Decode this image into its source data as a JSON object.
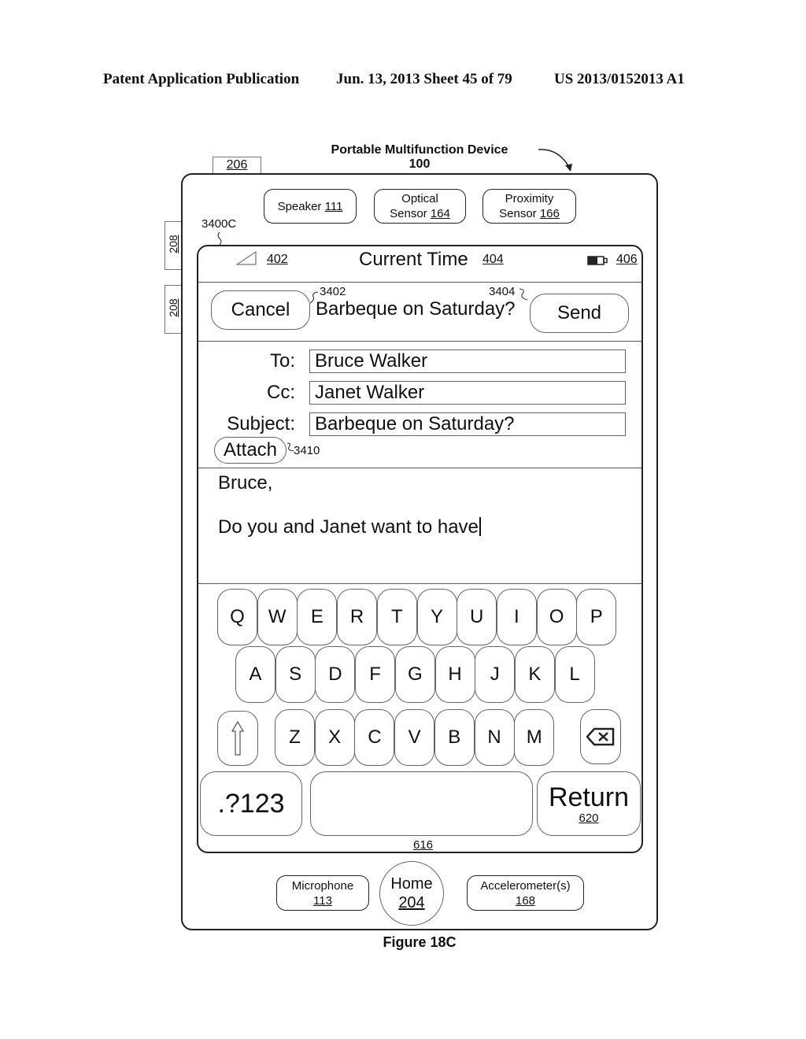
{
  "header": {
    "publication": "Patent Application Publication",
    "date_sheet": "Jun. 13, 2013  Sheet 45 of 79",
    "patent_number": "US 2013/0152013 A1"
  },
  "device": {
    "title": "Portable Multifunction Device",
    "ref": "100",
    "tab_top_ref": "206",
    "side_button_refs": [
      "208",
      "208"
    ],
    "screen_ref": "3400C",
    "top_hardware": [
      {
        "line1": "Speaker",
        "ref": "111"
      },
      {
        "line1": "Optical",
        "line2": "Sensor",
        "ref": "164"
      },
      {
        "line1": "Proximity",
        "line2": "Sensor",
        "ref": "166"
      }
    ],
    "bottom_hardware": [
      {
        "label": "Microphone",
        "ref": "113"
      },
      {
        "label": "Home",
        "ref": "204"
      },
      {
        "label": "Accelerometer(s)",
        "ref": "168"
      }
    ]
  },
  "status_bar": {
    "signal_ref": "402",
    "time_label": "Current Time",
    "time_ref": "404",
    "battery_ref": "406"
  },
  "nav": {
    "cancel_label": "Cancel",
    "cancel_ref": "3402",
    "title": "Barbeque on Saturday?",
    "send_ref": "3404",
    "send_label": "Send"
  },
  "compose": {
    "to_label": "To:",
    "to_value": "Bruce Walker",
    "cc_label": "Cc:",
    "cc_value": "Janet Walker",
    "subject_label": "Subject:",
    "subject_value": "Barbeque on Saturday?",
    "attach_label": "Attach",
    "attach_ref": "3410",
    "body_line1": "Bruce,",
    "body_line2": "Do you and Janet want to have"
  },
  "keyboard": {
    "row1": [
      "Q",
      "W",
      "E",
      "R",
      "T",
      "Y",
      "U",
      "I",
      "O",
      "P"
    ],
    "row2": [
      "A",
      "S",
      "D",
      "F",
      "G",
      "H",
      "J",
      "K",
      "L"
    ],
    "row3": [
      "Z",
      "X",
      "C",
      "V",
      "B",
      "N",
      "M"
    ],
    "numbers_label": ".?123",
    "return_label": "Return",
    "return_ref": "620",
    "keyboard_ref": "616"
  },
  "figure_caption": "Figure 18C"
}
